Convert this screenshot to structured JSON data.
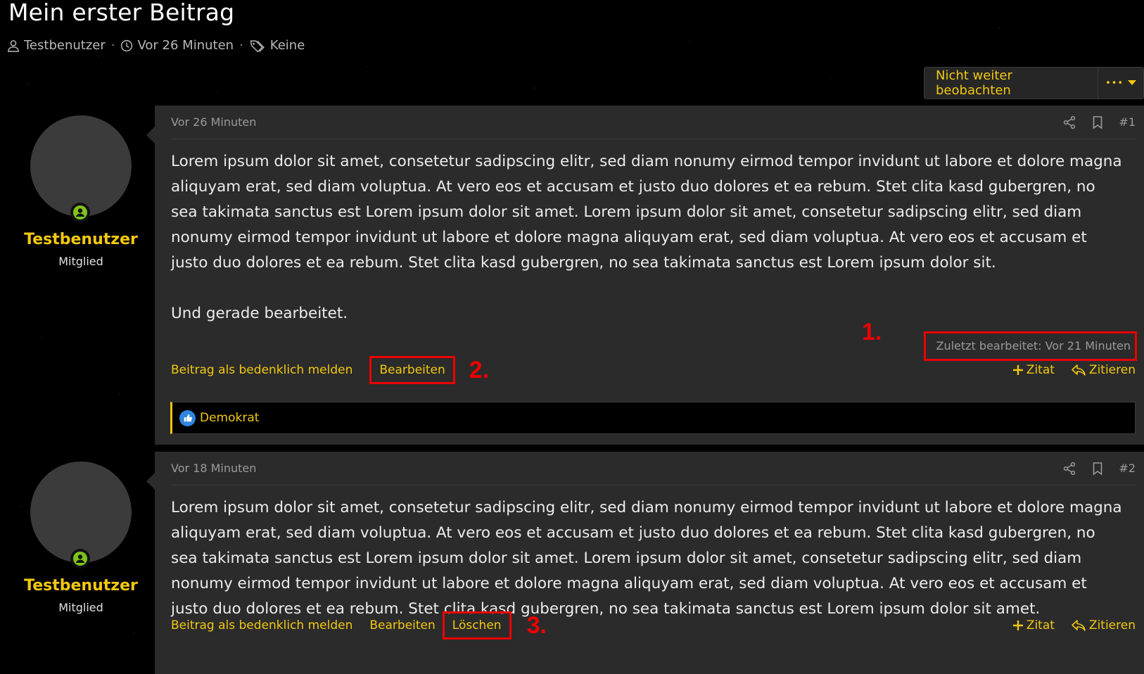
{
  "thread": {
    "title": "Mein erster Beitrag",
    "author": "Testbenutzer",
    "time": "Vor 26 Minuten",
    "tags": "Keine",
    "sep": "·"
  },
  "watch": {
    "label": "Nicht weiter beobachten",
    "more": "•••"
  },
  "posts": [
    {
      "username": "Testbenutzer",
      "usertitle": "Mitglied",
      "date": "Vor 26 Minuten",
      "number": "#1",
      "paragraphs": [
        "Lorem ipsum dolor sit amet, consetetur sadipscing elitr, sed diam nonumy eirmod tempor invidunt ut labore et dolore magna aliquyam erat, sed diam voluptua. At vero eos et accusam et justo duo dolores et ea rebum. Stet clita kasd gubergren, no sea takimata sanctus est Lorem ipsum dolor sit amet. Lorem ipsum dolor sit amet, consetetur sadipscing elitr, sed diam nonumy eirmod tempor invidunt ut labore et dolore magna aliquyam erat, sed diam voluptua. At vero eos et accusam et justo duo dolores et ea rebum. Stet clita kasd gubergren, no sea takimata sanctus est Lorem ipsum dolor sit.",
        "Und gerade bearbeitet."
      ],
      "edited": "Zuletzt bearbeitet: Vor 21 Minuten",
      "report": "Beitrag als bedenklich melden",
      "edit": "Bearbeiten",
      "add_quote": "Zitat",
      "quote": "Zitieren",
      "reaction_user": "Demokrat"
    },
    {
      "username": "Testbenutzer",
      "usertitle": "Mitglied",
      "date": "Vor 18 Minuten",
      "number": "#2",
      "paragraphs": [
        "Lorem ipsum dolor sit amet, consetetur sadipscing elitr, sed diam nonumy eirmod tempor invidunt ut labore et dolore magna aliquyam erat, sed diam voluptua. At vero eos et accusam et justo duo dolores et ea rebum. Stet clita kasd gubergren, no sea takimata sanctus est Lorem ipsum dolor sit amet. Lorem ipsum dolor sit amet, consetetur sadipscing elitr, sed diam nonumy eirmod tempor invidunt ut labore et dolore magna aliquyam erat, sed diam voluptua. At vero eos et accusam et justo duo dolores et ea rebum. Stet clita kasd gubergren, no sea takimata sanctus est Lorem ipsum dolor sit amet."
      ],
      "report": "Beitrag als bedenklich melden",
      "edit": "Bearbeiten",
      "delete": "Löschen",
      "add_quote": "Zitat",
      "quote": "Zitieren"
    }
  ],
  "markers": {
    "m1": "1.",
    "m2": "2.",
    "m3": "3."
  },
  "colors": {
    "accent": "#f2c811",
    "highlight": "#e00000",
    "online": "#7fc31c",
    "like": "#2f86e0"
  }
}
